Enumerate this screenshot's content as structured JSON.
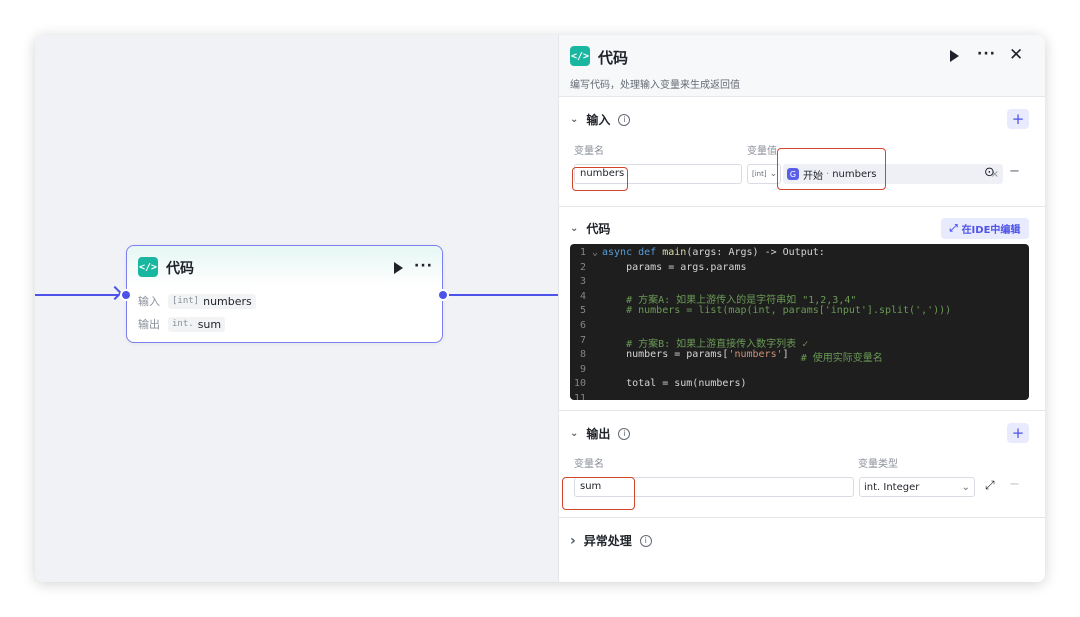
{
  "node": {
    "title": "代码",
    "input_label": "输入",
    "input_var": "numbers",
    "input_type": "[int]",
    "output_label": "输出",
    "output_var": "sum",
    "output_type": "int."
  },
  "panel": {
    "title": "代码",
    "description": "编写代码，处理输入变量来生成返回值",
    "input_section": {
      "title": "输入",
      "col_name": "变量名",
      "col_value": "变量值",
      "var_name": "numbers",
      "type_icon": "[int]",
      "ref_source": "开始",
      "ref_var": "numbers",
      "ref_icon": "G"
    },
    "code_section": {
      "title": "代码",
      "ide_button": "在IDE中编辑"
    },
    "output_section": {
      "title": "输出",
      "col_name": "变量名",
      "col_type": "变量类型",
      "var_name": "sum",
      "type_value": "int. Integer"
    },
    "error_section": {
      "title": "异常处理"
    }
  },
  "code_lines": [
    {
      "n": "1",
      "mark": "⌄",
      "tokens": [
        [
          "kw",
          "async def "
        ],
        [
          "fn",
          "main"
        ],
        [
          "txt",
          "(args: Args) -> Output:"
        ]
      ]
    },
    {
      "n": "2",
      "mark": "",
      "tokens": [
        [
          "txt",
          "    params = args.params"
        ]
      ]
    },
    {
      "n": "3",
      "mark": "",
      "tokens": [
        [
          "txt",
          ""
        ]
      ]
    },
    {
      "n": "4",
      "mark": "",
      "tokens": [
        [
          "cm",
          "    # 方案A: 如果上游传入的是字符串如 \"1,2,3,4\""
        ]
      ]
    },
    {
      "n": "5",
      "mark": "",
      "tokens": [
        [
          "cm",
          "    # numbers = list(map(int, params['input'].split(',')))"
        ]
      ]
    },
    {
      "n": "6",
      "mark": "",
      "tokens": [
        [
          "txt",
          ""
        ]
      ]
    },
    {
      "n": "7",
      "mark": "",
      "tokens": [
        [
          "cm",
          "    # 方案B: 如果上游直接传入数字列表 ✓"
        ]
      ]
    },
    {
      "n": "8",
      "mark": "",
      "tokens": [
        [
          "txt",
          "    numbers = params["
        ],
        [
          "str",
          "'numbers'"
        ],
        [
          "txt",
          "]  "
        ],
        [
          "cm",
          "# 使用实际变量名"
        ]
      ]
    },
    {
      "n": "9",
      "mark": "",
      "tokens": [
        [
          "txt",
          ""
        ]
      ]
    },
    {
      "n": "10",
      "mark": "",
      "tokens": [
        [
          "txt",
          "    total = sum(numbers)"
        ]
      ]
    },
    {
      "n": "11",
      "mark": "",
      "tokens": [
        [
          "txt",
          ""
        ]
      ]
    }
  ],
  "icons": {
    "code": "</>",
    "play": "play-icon",
    "more": "···",
    "close": "✕",
    "plus": "+",
    "minus": "−",
    "info": "i",
    "expand": "⤢",
    "chevron_down": "⌄",
    "chevron_right": "›",
    "clear": "×",
    "target": "⊙"
  },
  "colors": {
    "accent": "#4d53e8",
    "code_icon": "#19b79f",
    "highlight": "#d2452a",
    "editor_bg": "#1e1e1e"
  }
}
